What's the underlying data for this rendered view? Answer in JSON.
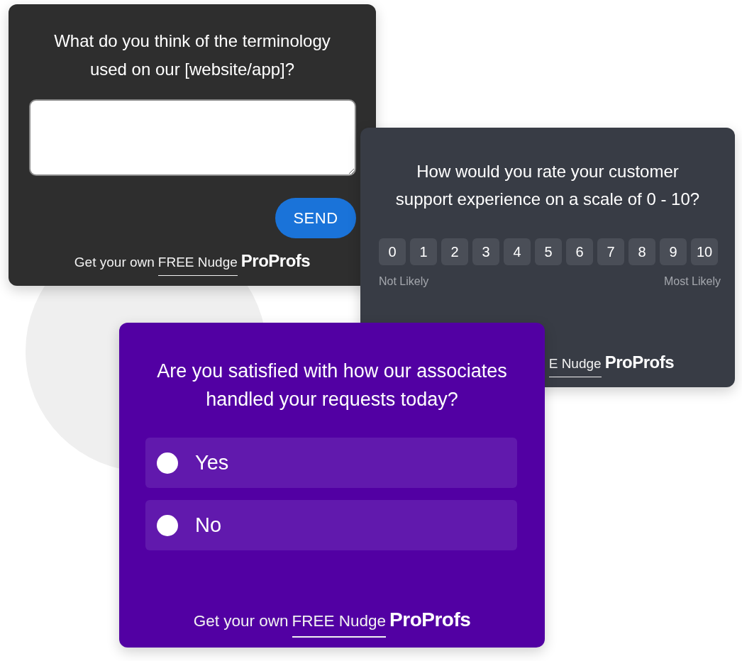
{
  "cards": [
    {
      "kind": "text",
      "question": "What do you think of the terminology used on our [website/app]?",
      "button": "SEND",
      "footer": {
        "prefix": "Get your own",
        "link": "FREE Nudge",
        "logo": "ProProfs"
      }
    },
    {
      "kind": "scale",
      "question": "How would you rate your customer support experience on a scale of 0 - 10?",
      "scale": [
        {
          "label": "0",
          "selected": false
        },
        {
          "label": "1",
          "selected": false
        },
        {
          "label": "2",
          "selected": false
        },
        {
          "label": "3",
          "selected": false
        },
        {
          "label": "4",
          "selected": false
        },
        {
          "label": "5",
          "selected": false
        },
        {
          "label": "6",
          "selected": false
        },
        {
          "label": "7",
          "selected": false
        },
        {
          "label": "8",
          "selected": false
        },
        {
          "label": "9",
          "selected": false
        },
        {
          "label": "10",
          "selected": false
        }
      ],
      "low_label": "Not Likely",
      "high_label": "Most Likely",
      "footer": {
        "link": "E Nudge",
        "logo": "ProProfs"
      }
    },
    {
      "kind": "choice",
      "question": "Are you satisfied with how our associates handled your requests today?",
      "options": [
        {
          "label": "Yes",
          "selected": false
        },
        {
          "label": "No",
          "selected": false
        }
      ],
      "footer": {
        "prefix": "Get your own",
        "link": "FREE Nudge",
        "logo": "ProProfs"
      }
    }
  ]
}
